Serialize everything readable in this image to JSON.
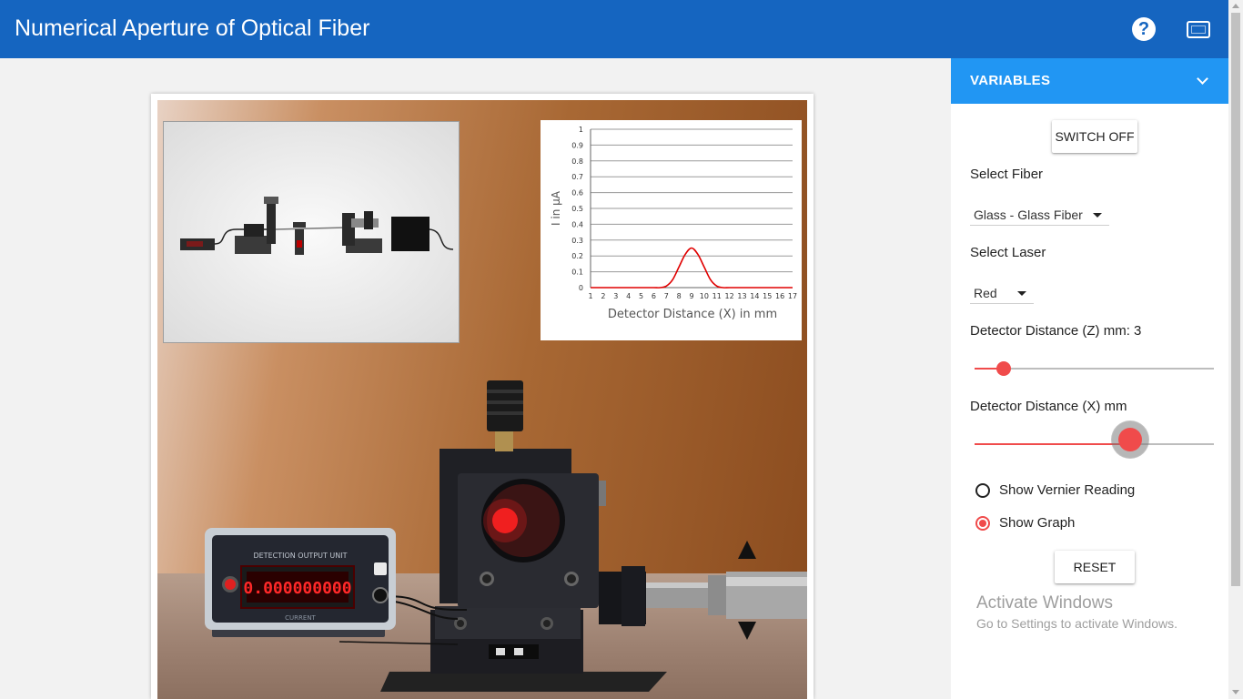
{
  "header": {
    "title": "Numerical Aperture of Optical Fiber",
    "help_symbol": "?",
    "icons": [
      "help-icon",
      "fullscreen-icon"
    ]
  },
  "panel": {
    "title": "VARIABLES",
    "switch_label": "SWITCH OFF",
    "fiber_label": "Select Fiber",
    "fiber_value": "Glass - Glass Fiber",
    "laser_label": "Select Laser",
    "laser_value": "Red",
    "z_label": "Detector Distance (Z) mm: 3",
    "z_fraction": 0.12,
    "x_label": "Detector Distance (X) mm",
    "x_fraction": 0.65,
    "vernier_label": "Show Vernier Reading",
    "vernier_checked": false,
    "graph_label": "Show Graph",
    "graph_checked": true,
    "reset_label": "RESET",
    "accent_color": "#f04b4b"
  },
  "detector": {
    "unit_title": "DETECTION OUTPUT UNIT",
    "reading": "0.000000000",
    "footer": "CURRENT"
  },
  "graph": {
    "ylabel": "I in μA",
    "xlabel": "Detector Distance (X) in mm"
  },
  "chart_data": {
    "type": "line",
    "title": "",
    "xlabel": "Detector Distance (X) in mm",
    "ylabel": "I in μA",
    "xlim": [
      1,
      17
    ],
    "ylim": [
      0,
      1
    ],
    "xticks": [
      "1",
      "2",
      "3",
      "4",
      "5",
      "6",
      "7",
      "8",
      "9",
      "10",
      "11",
      "12",
      "13",
      "14",
      "15",
      "16",
      "17"
    ],
    "yticks": [
      "0",
      "0.1",
      "0.2",
      "0.3",
      "0.4",
      "0.5",
      "0.6",
      "0.7",
      "0.8",
      "0.9",
      "1"
    ],
    "grid": true,
    "color": "#e00000",
    "x": [
      1,
      2,
      3,
      4,
      5,
      6,
      6.5,
      7,
      7.5,
      8,
      8.5,
      9,
      9.5,
      10,
      10.5,
      11,
      11.5,
      12,
      13,
      14,
      15,
      16,
      17
    ],
    "y": [
      0,
      0,
      0,
      0,
      0,
      0,
      0,
      0.01,
      0.05,
      0.13,
      0.21,
      0.25,
      0.21,
      0.13,
      0.05,
      0.01,
      0,
      0,
      0,
      0,
      0,
      0,
      0
    ]
  },
  "watermark": {
    "title": "Activate Windows",
    "subtitle": "Go to Settings to activate Windows."
  }
}
